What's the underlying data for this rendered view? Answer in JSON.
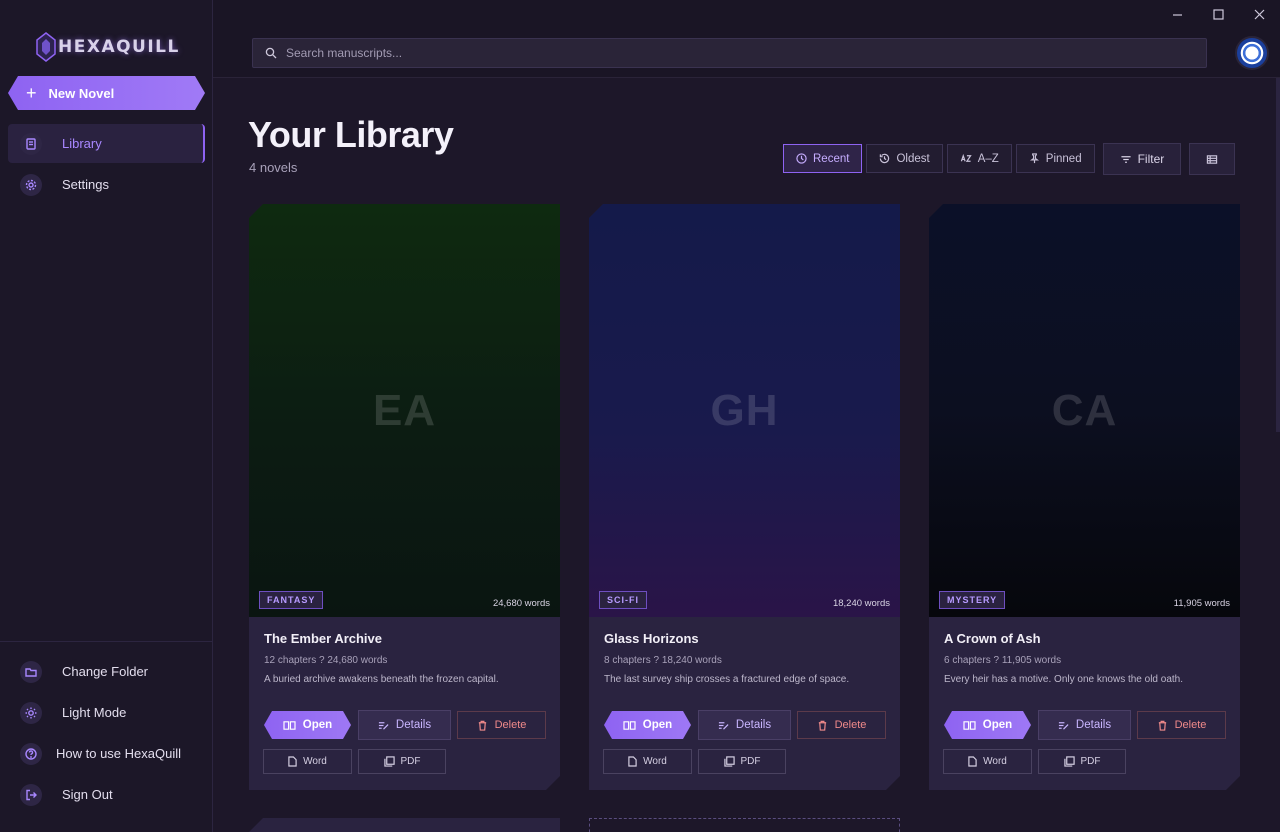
{
  "window": {
    "minimize": "—",
    "maximize": "□",
    "close": "✕"
  },
  "sidebar": {
    "logo_text": "HEXAQUILL",
    "new_novel_label": "New Novel",
    "nav": [
      {
        "label": "Library",
        "icon": "library-icon",
        "active": true
      },
      {
        "label": "Settings",
        "icon": "gear-icon",
        "active": false
      }
    ],
    "bottom": [
      {
        "label": "Change Folder",
        "icon": "folder-icon"
      },
      {
        "label": "Light Mode",
        "icon": "sun-icon"
      },
      {
        "label": "How to use HexaQuill",
        "icon": "help-icon"
      },
      {
        "label": "Sign Out",
        "icon": "sign-out-icon"
      }
    ]
  },
  "search": {
    "placeholder": "Search manuscripts..."
  },
  "library": {
    "title": "Your Library",
    "count": "4 novels",
    "sort": [
      {
        "label": "Recent",
        "icon": "clock-icon",
        "active": true
      },
      {
        "label": "Oldest",
        "icon": "history-icon",
        "active": false
      },
      {
        "label": "A–Z",
        "icon": "sort-alpha-icon",
        "active": false
      },
      {
        "label": "Pinned",
        "icon": "pin-icon",
        "active": false
      }
    ],
    "filter_label": "Filter",
    "view_icon": "list-view-icon"
  },
  "novels": [
    {
      "initials": "EA",
      "genre": "FANTASY",
      "words_badge": "24,680 words",
      "title": "The Ember Archive",
      "meta": "12 chapters ? 24,680 words",
      "description": "A buried archive awakens beneath the frozen capital.",
      "cover_colors": [
        "#0d2a0f",
        "#0a1a12",
        "#0b1712"
      ]
    },
    {
      "initials": "GH",
      "genre": "SCI-FI",
      "words_badge": "18,240 words",
      "title": "Glass Horizons",
      "meta": "8 chapters ? 18,240 words",
      "description": "The last survey ship crosses a fractured edge of space.",
      "cover_colors": [
        "#141a48",
        "#18184a",
        "#2a1448"
      ]
    },
    {
      "initials": "CA",
      "genre": "MYSTERY",
      "words_badge": "11,905 words",
      "title": "A Crown of Ash",
      "meta": "6 chapters ? 11,905 words",
      "description": "Every heir has a motive. Only one knows the old oath.",
      "cover_colors": [
        "#0a1028",
        "#0c0f20",
        "#06070d"
      ]
    }
  ],
  "card_actions": {
    "open": "Open",
    "details": "Details",
    "delete": "Delete",
    "word": "Word",
    "pdf": "PDF"
  },
  "colors": {
    "accent": "#8e63f2",
    "background": "#1a1525",
    "danger": "#f08a8a"
  }
}
